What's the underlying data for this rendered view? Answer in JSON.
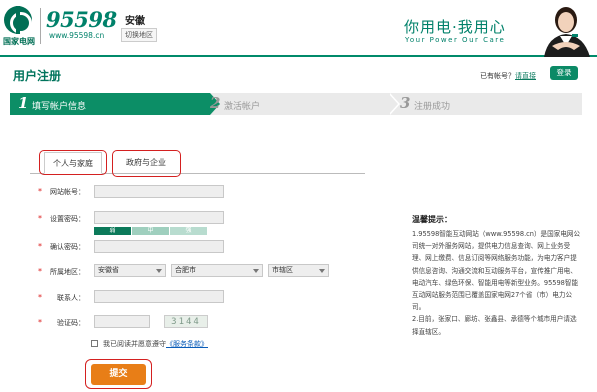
{
  "header": {
    "logo_org": "国家电网",
    "logo_number": "95598",
    "logo_url": "www.95598.cn",
    "province": "安徽",
    "switch_city": "切换地区",
    "slogan_cn": "你用电·我用心",
    "slogan_en": "Your Power  Our Care"
  },
  "title_bar": {
    "page_title": "用户注册",
    "have_account_prefix": "已有帐号？",
    "have_account_link": "请直接",
    "login_label": "登录"
  },
  "steps": [
    {
      "num": "1",
      "label": "填写帐户信息",
      "active": true
    },
    {
      "num": "2",
      "label": "激活帐户",
      "active": false
    },
    {
      "num": "3",
      "label": "注册成功",
      "active": false
    }
  ],
  "tabs": {
    "personal": "个人与家庭",
    "organization": "政府与企业"
  },
  "form": {
    "username_label": "网站帐号：",
    "password_label": "设置密码：",
    "strength": [
      "弱",
      "中",
      "强"
    ],
    "confirm_label": "确认密码：",
    "region_label": "所属地区：",
    "region_province": "安徽省",
    "region_city": "合肥市",
    "region_district": "市辖区",
    "contact_label": "联系人：",
    "captcha_label": "验证码：",
    "captcha_text": "3144",
    "agree_prefix": "我已阅读并愿意遵守",
    "agree_link": "《服务条款》",
    "submit_label": "提交"
  },
  "notice": {
    "title": "温馨提示：",
    "body": "1.95598智能互动网站（www.95598.cn）是国家电网公司统一对外服务网站，提供电力信息查询、网上业务受理、网上缴费、信息订阅等网络服务功能，为电力客户提供信息咨询、沟通交流和互动服务平台，宣传推广用电、电动汽车、绿色环保、智能用电等新型业务。95598智能互动网站服务范围已覆盖国家电网27个省（市）电力公司。\n2.目前，张家口、廊坊、张鑫县、承德等个城市用户请选择直辖区。"
  },
  "colors": {
    "brand_green": "#0c8e66",
    "submit_orange": "#e87e17",
    "highlight_red": "#d42020"
  }
}
